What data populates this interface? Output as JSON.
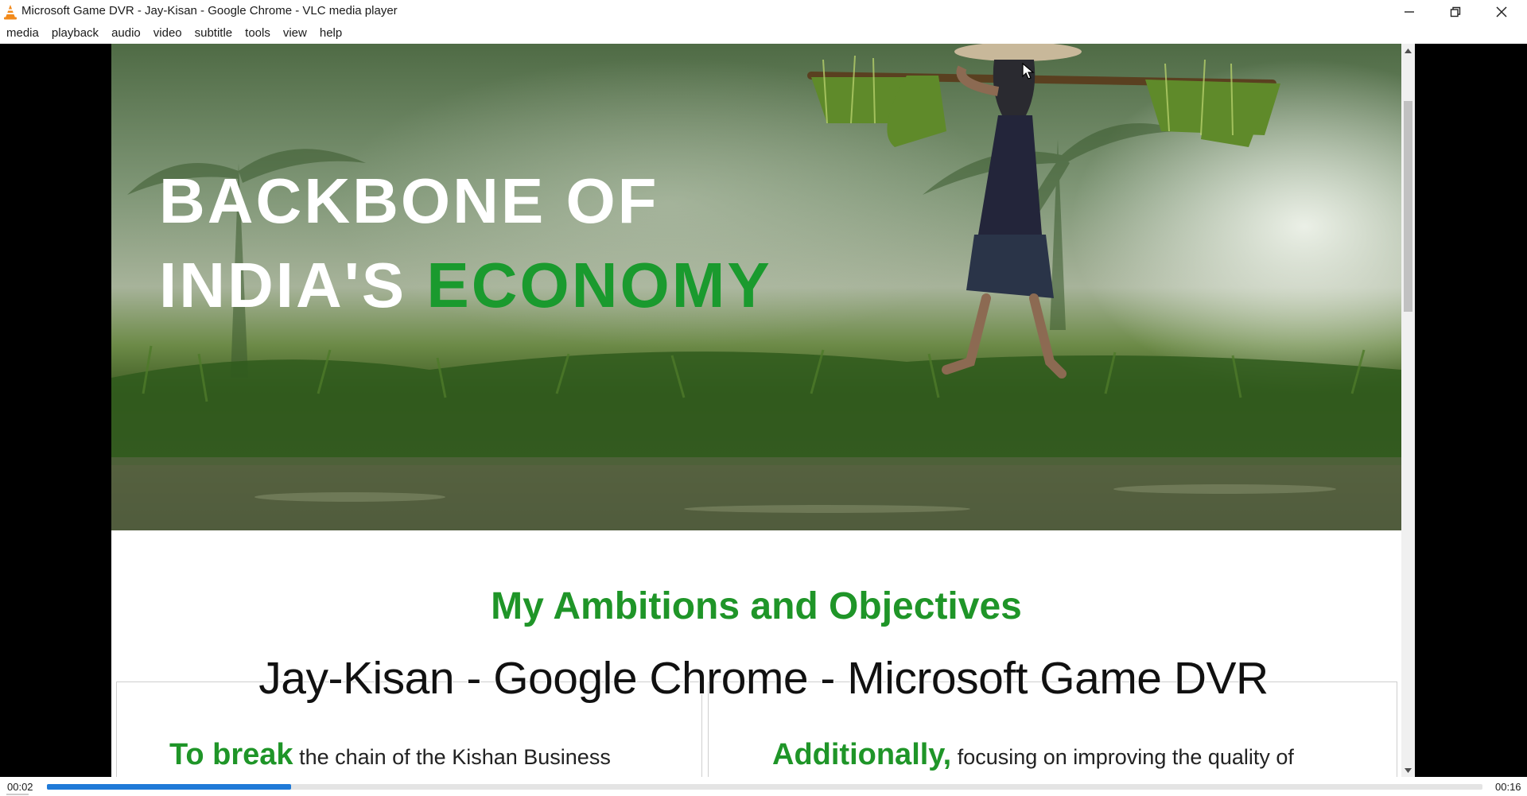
{
  "window": {
    "title": "Microsoft Game DVR - Jay-Kisan - Google Chrome - VLC media player",
    "icon": "vlc-cone-icon",
    "controls": [
      "minimize-icon",
      "restore-icon",
      "close-icon"
    ]
  },
  "menu": {
    "items": [
      "media",
      "playback",
      "audio",
      "video",
      "subtitle",
      "tools",
      "view",
      "help"
    ]
  },
  "content": {
    "hero_line1": "BACKBONE OF",
    "hero_line2_white": "INDIA'S ",
    "hero_line2_green": "ECONOMY",
    "heading": "My Ambitions and Objectives",
    "card_left_lead": "To break",
    "card_left_text": " the chain of the Kishan Business",
    "card_right_lead": "Additionally,",
    "card_right_text": " focusing on improving the quality of"
  },
  "overlay": {
    "caption": "Jay-Kisan - Google Chrome - Microsoft Game DVR"
  },
  "player": {
    "elapsed": "00:02",
    "duration": "00:16",
    "progress_fraction": 0.17
  },
  "colors": {
    "accent_green": "#1f9528",
    "seek_blue": "#1f7ad8",
    "vlc_orange": "#f28a1b"
  }
}
